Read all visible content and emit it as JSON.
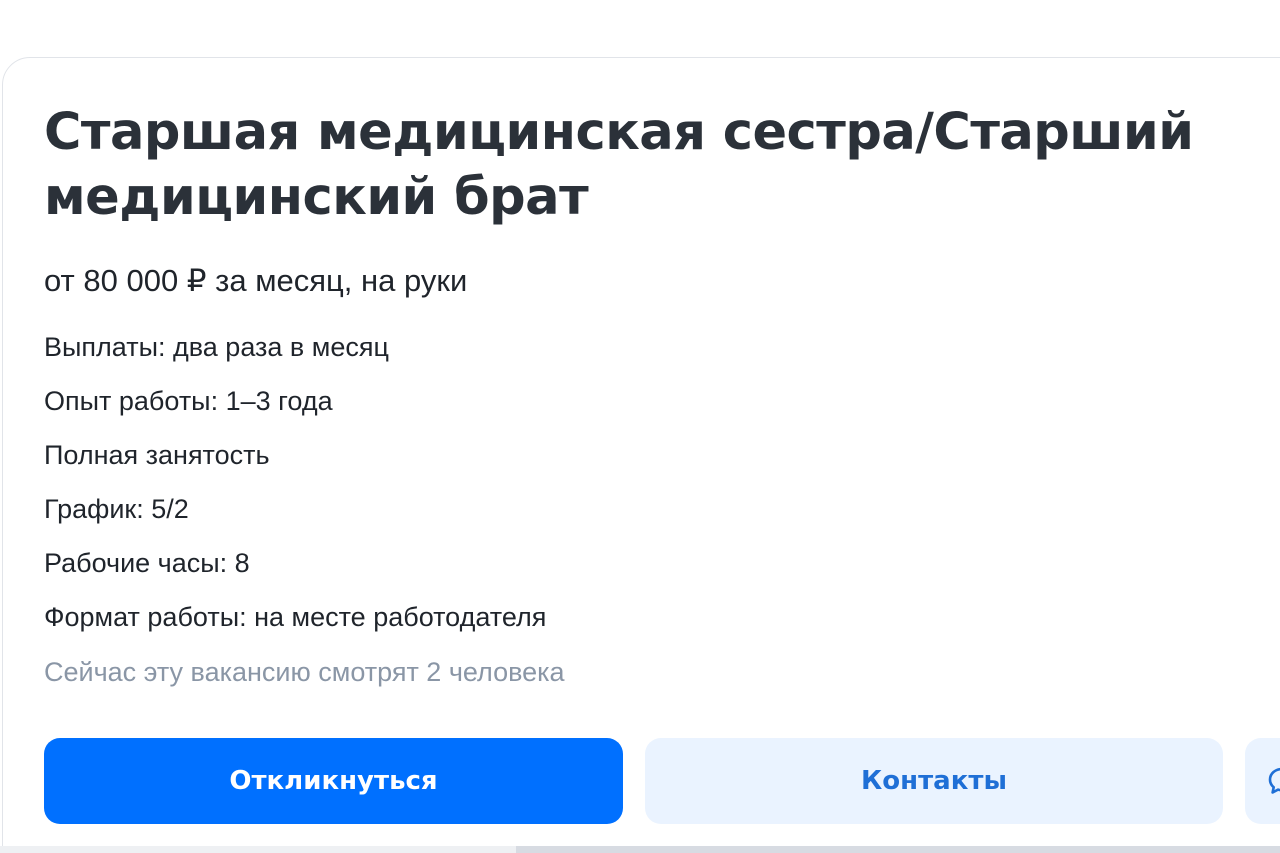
{
  "vacancy": {
    "title_line1": "Старшая медицинская сестра/Старший",
    "title_line2": "медицинский брат",
    "salary": "от 80 000 ₽ за месяц, на руки",
    "facts": [
      "Выплаты: два раза в месяц",
      "Опыт работы: 1–3 года",
      "Полная занятость",
      "График: 5/2",
      "Рабочие часы: 8",
      "Формат работы: на месте работодателя"
    ],
    "viewers": "Сейчас эту вакансию смотрят 2 человека"
  },
  "actions": {
    "respond_label": "Откликнуться",
    "contacts_label": "Контакты",
    "chat_icon": "chat-icon"
  },
  "colors": {
    "primary": "#0070ff",
    "secondary_bg": "#eaf3ff",
    "secondary_text": "#1f6fd6",
    "muted_text": "#8a96a6",
    "title_text": "#2b3139"
  }
}
